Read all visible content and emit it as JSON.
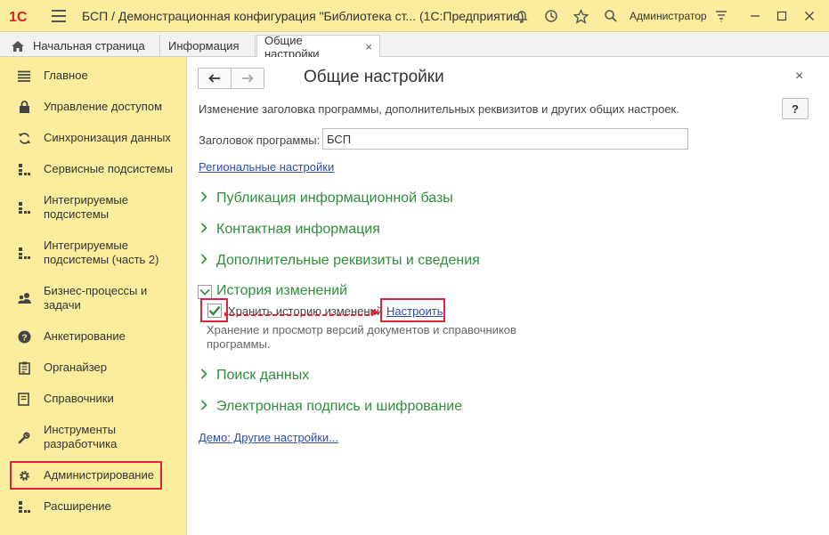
{
  "window": {
    "logo_text": "1С",
    "title": "БСП / Демонстрационная конфигурация \"Библиотека ст...  (1С:Предприятие)",
    "user": "Администратор",
    "icons": [
      "bell-icon",
      "history-icon",
      "star-icon",
      "search-icon",
      "settings-icon"
    ]
  },
  "tabs": [
    {
      "label": "Начальная страница",
      "icon": "home-icon"
    },
    {
      "label": "Информация"
    },
    {
      "label": "Общие настройки",
      "active": true,
      "close": "×"
    }
  ],
  "sidebar": {
    "items": [
      {
        "label": "Главное",
        "icon": "menu-icon"
      },
      {
        "label": "Управление доступом",
        "icon": "lock-icon"
      },
      {
        "label": "Синхронизация данных",
        "icon": "sync-icon"
      },
      {
        "label": "Сервисные подсистемы",
        "icon": "subsystems-icon"
      },
      {
        "label": "Интегрируемые подсистемы",
        "icon": "subsystems-icon"
      },
      {
        "label": "Интегрируемые подсистемы (часть 2)",
        "icon": "subsystems-icon"
      },
      {
        "label": "Бизнес-процессы и задачи",
        "icon": "people-icon"
      },
      {
        "label": "Анкетирование",
        "icon": "question-icon"
      },
      {
        "label": "Органайзер",
        "icon": "organizer-icon"
      },
      {
        "label": "Справочники",
        "icon": "book-icon"
      },
      {
        "label": "Инструменты разработчика",
        "icon": "wrench-icon"
      },
      {
        "label": "Администрирование",
        "icon": "gear-icon",
        "highlighted": true
      },
      {
        "label": "Расширение",
        "icon": "subsystems-icon"
      }
    ]
  },
  "main": {
    "title": "Общие настройки",
    "close": "×",
    "help": "?",
    "description": "Изменение заголовка программы, дополнительных реквизитов и других общих настроек.",
    "field_label": "Заголовок программы:",
    "field_value": "БСП",
    "regional_link": "Региональные настройки",
    "groups": [
      "Публикация информационной базы",
      "Контактная информация",
      "Дополнительные реквизиты и сведения"
    ],
    "history": {
      "title": "История изменений",
      "checkbox_label": "Хранить историю изменений",
      "checked": true,
      "setup_link": "Настроить",
      "hint": "Хранение и просмотр версий документов и справочников программы."
    },
    "groups_after": [
      "Поиск данных",
      "Электронная подпись и шифрование"
    ],
    "demo_link": "Демо: Другие настройки..."
  },
  "colors": {
    "accent_yellow": "#fbed9e",
    "group_green": "#2f8e3c",
    "highlight_red": "#e0223a",
    "link_blue": "#2b4fae"
  }
}
